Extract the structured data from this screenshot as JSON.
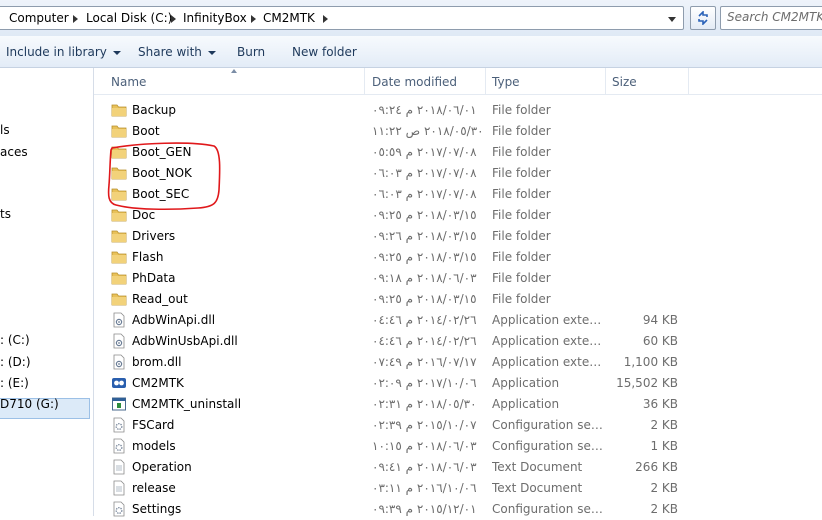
{
  "address": {
    "crumbs": [
      "Computer",
      "Local Disk (C:)",
      "InfinityBox",
      "CM2MTK"
    ],
    "search_placeholder": "Search CM2MTK"
  },
  "toolbar": {
    "include_label": "Include in library",
    "share_label": "Share with",
    "burn_label": "Burn",
    "new_folder_label": "New folder"
  },
  "nav": {
    "items": [
      "ls",
      "aces",
      "ts",
      ": (C:)",
      ": (D:)",
      ": (E:)",
      "D710 (G:)"
    ],
    "selected_index": 3
  },
  "columns": {
    "name": "Name",
    "date": "Date modified",
    "type": "Type",
    "size": "Size"
  },
  "files": [
    {
      "name": "Backup",
      "date": "٢٠١٨/٠٦/٠١ م ٠٩:٢٤",
      "type": "File folder",
      "size": "",
      "icon": "folder-icon"
    },
    {
      "name": "Boot",
      "date": "٢٠١٨/٠٥/٣٠ ص ١١:٢٢",
      "type": "File folder",
      "size": "",
      "icon": "folder-icon"
    },
    {
      "name": "Boot_GEN",
      "date": "٢٠١٧/٠٧/٠٨ م ٠٥:٥٩",
      "type": "File folder",
      "size": "",
      "icon": "folder-icon"
    },
    {
      "name": "Boot_NOK",
      "date": "٢٠١٧/٠٧/٠٨ م ٠٦:٠٣",
      "type": "File folder",
      "size": "",
      "icon": "folder-icon"
    },
    {
      "name": "Boot_SEC",
      "date": "٢٠١٧/٠٧/٠٨ م ٠٦:٠٣",
      "type": "File folder",
      "size": "",
      "icon": "folder-icon"
    },
    {
      "name": "Doc",
      "date": "٢٠١٨/٠٣/١٥ م ٠٩:٢٥",
      "type": "File folder",
      "size": "",
      "icon": "folder-icon"
    },
    {
      "name": "Drivers",
      "date": "٢٠١٨/٠٣/١٥ م ٠٩:٢٦",
      "type": "File folder",
      "size": "",
      "icon": "folder-icon"
    },
    {
      "name": "Flash",
      "date": "٢٠١٨/٠٣/١٥ م ٠٩:٢٥",
      "type": "File folder",
      "size": "",
      "icon": "folder-icon"
    },
    {
      "name": "PhData",
      "date": "٢٠١٨/٠٦/٠٣ م ٠٩:١٨",
      "type": "File folder",
      "size": "",
      "icon": "folder-icon"
    },
    {
      "name": "Read_out",
      "date": "٢٠١٨/٠٣/١٥ م ٠٩:٢٥",
      "type": "File folder",
      "size": "",
      "icon": "folder-icon"
    },
    {
      "name": "AdbWinApi.dll",
      "date": "٢٠١٤/٠٢/٢٦ م ٠٤:٤٦",
      "type": "Application extens...",
      "size": "94 KB",
      "icon": "dll-icon"
    },
    {
      "name": "AdbWinUsbApi.dll",
      "date": "٢٠١٤/٠٢/٢٦ م ٠٤:٤٦",
      "type": "Application extens...",
      "size": "60 KB",
      "icon": "dll-icon"
    },
    {
      "name": "brom.dll",
      "date": "٢٠١٦/٠٧/١٧ م ٠٧:٤٩",
      "type": "Application extens...",
      "size": "1,100 KB",
      "icon": "dll-icon"
    },
    {
      "name": "CM2MTK",
      "date": "٢٠١٧/١٠/٠٦ م ٠٢:٠٩",
      "type": "Application",
      "size": "15,502 KB",
      "icon": "app-icon"
    },
    {
      "name": "CM2MTK_uninstall",
      "date": "٢٠١٨/٠٥/٣٠ م ٠٢:٣١",
      "type": "Application",
      "size": "36 KB",
      "icon": "uninstall-icon"
    },
    {
      "name": "FSCard",
      "date": "٢٠١٥/١٠/٠٧ م ٠٢:٣٩",
      "type": "Configuration sett...",
      "size": "2 KB",
      "icon": "config-icon"
    },
    {
      "name": "models",
      "date": "٢٠١٨/٠٦/٠٣ م ١٠:١٥",
      "type": "Configuration sett...",
      "size": "1 KB",
      "icon": "config-icon"
    },
    {
      "name": "Operation",
      "date": "٢٠١٨/٠٦/٠٣ م ٠٩:٤١",
      "type": "Text Document",
      "size": "266 KB",
      "icon": "text-file-icon"
    },
    {
      "name": "release",
      "date": "٢٠١٦/١٠/٠٦ م ٠٣:١١",
      "type": "Text Document",
      "size": "2 KB",
      "icon": "text-file-icon"
    },
    {
      "name": "Settings",
      "date": "٢٠١٥/١٢/٠١ م ٠٩:٣٩",
      "type": "Configuration sett...",
      "size": "2 KB",
      "icon": "config-icon"
    }
  ],
  "colors": {
    "folder": "#e8c15a",
    "annotation": "#e0181b",
    "command_text": "#1e395b"
  }
}
